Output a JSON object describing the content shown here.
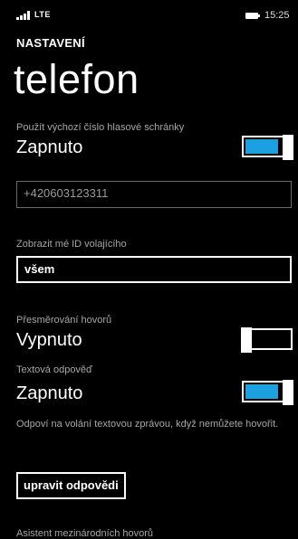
{
  "status": {
    "network": "LTE",
    "time": "15:25"
  },
  "header": {
    "app_title": "NASTAVENÍ",
    "page_title": "telefon"
  },
  "voicemail": {
    "label": "Použít výchozí číslo hlasové schránky",
    "state": "Zapnuto",
    "on": true,
    "number": "+420603123311"
  },
  "caller_id": {
    "label": "Zobrazit mé ID volajícího",
    "value": "všem"
  },
  "forwarding": {
    "label": "Přesměrování hovorů",
    "state": "Vypnuto",
    "on": false
  },
  "text_reply": {
    "label": "Textová odpověď",
    "state": "Zapnuto",
    "on": true,
    "description": "Odpoví na volání textovou zprávou, když nemůžete hovořit.",
    "button": "upravit odpovědi"
  },
  "intl_assist": {
    "label": "Asistent mezinárodních hovorů"
  },
  "colors": {
    "accent": "#1ba1e2",
    "background": "#000000"
  }
}
